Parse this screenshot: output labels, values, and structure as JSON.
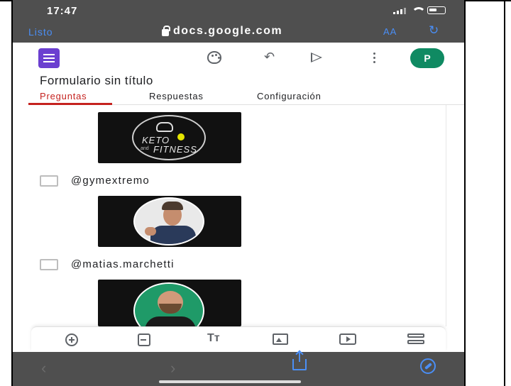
{
  "status_bar": {
    "time": "17:47"
  },
  "safari": {
    "done_label": "Listo",
    "url": "docs.google.com",
    "text_size_label": "AA",
    "reload_icon": "reload-icon"
  },
  "forms_toolbar": {
    "avatar_initial": "P",
    "icons": [
      "forms-logo-icon",
      "palette-icon",
      "undo-icon",
      "send-icon",
      "more-vert-icon"
    ]
  },
  "form": {
    "title": "Formulario sin título",
    "tabs": [
      {
        "label": "Preguntas",
        "active": true
      },
      {
        "label": "Respuestas",
        "active": false
      },
      {
        "label": "Configuración",
        "active": false
      }
    ],
    "top_image_text": {
      "line1": "KETO",
      "line2": "and",
      "line3": "FITNESS"
    },
    "options": [
      {
        "label": "@gymextremo",
        "checked": false
      },
      {
        "label": "@matias.marchetti",
        "checked": false
      }
    ]
  },
  "bottom_palette": {
    "icons": [
      "add-question-icon",
      "import-questions-icon",
      "add-title-icon",
      "add-image-icon",
      "add-video-icon",
      "add-section-icon"
    ]
  },
  "colors": {
    "accent_red": "#c5221f",
    "forms_purple": "#6b3fd0",
    "avatar_green": "#0f8a62",
    "safari_blue": "#4a8ef5",
    "chrome_gray": "#4f4f4f"
  }
}
